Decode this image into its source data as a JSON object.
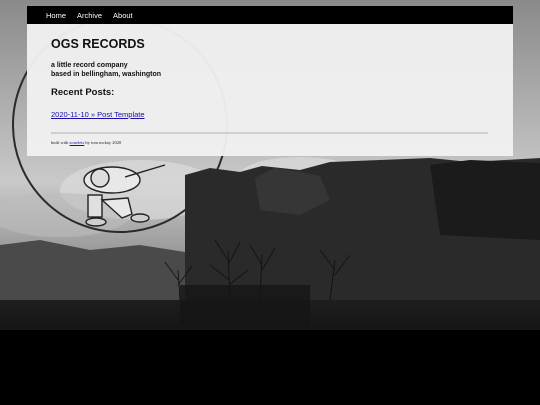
{
  "nav": {
    "items": [
      {
        "label": "Home"
      },
      {
        "label": "Archive"
      },
      {
        "label": "About"
      }
    ]
  },
  "site": {
    "title": "OGS RECORDS",
    "tagline_line1": "a little record company",
    "tagline_line2": "based in bellingham, washington"
  },
  "recent": {
    "heading": "Recent Posts:",
    "posts": [
      {
        "label": "2020-11-10 » Post Template"
      }
    ]
  },
  "footer": {
    "prefix": "built with",
    "link": "zonelets",
    "suffix": "by tom mckay 2020"
  },
  "colors": {
    "nav_bg": "#000000",
    "card_bg": "#f0f0f0",
    "link": "#1a0dab"
  }
}
